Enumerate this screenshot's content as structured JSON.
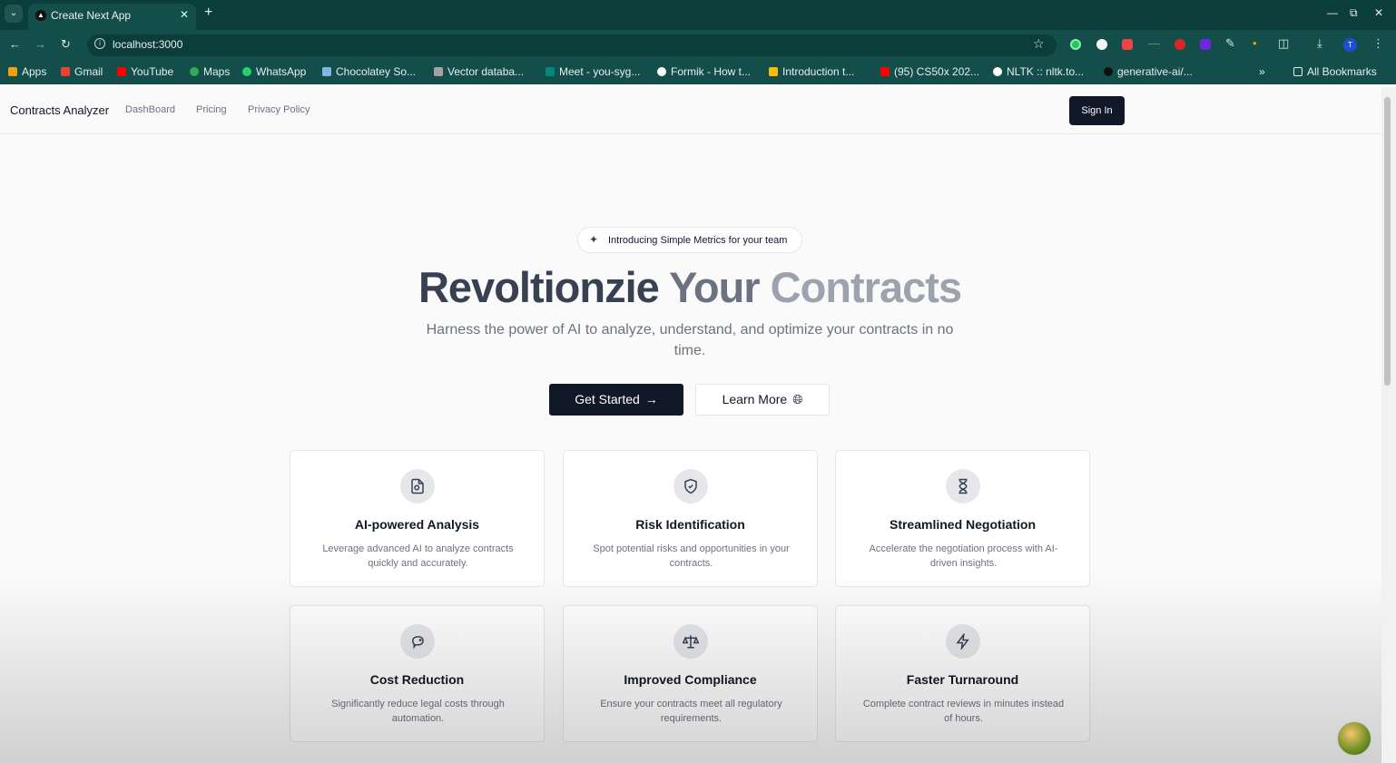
{
  "browser": {
    "tab_title": "Create Next App",
    "tab_favicon": "triangle-icon",
    "url": "localhost:3000",
    "bookmarks": [
      {
        "label": "Apps",
        "icon": "grid-icon",
        "color": "#f59e0b"
      },
      {
        "label": "Gmail",
        "icon": "gmail-icon",
        "color": "#ea4335"
      },
      {
        "label": "YouTube",
        "icon": "youtube-icon",
        "color": "#ff0000"
      },
      {
        "label": "Maps",
        "icon": "maps-icon",
        "color": "#34a853"
      },
      {
        "label": "WhatsApp",
        "icon": "whatsapp-icon",
        "color": "#25d366"
      },
      {
        "label": "Chocolatey So...",
        "icon": "chocolatey-icon",
        "color": "#80b5e3"
      },
      {
        "label": "Vector databa...",
        "icon": "vector-icon",
        "color": "#a3a3a3"
      },
      {
        "label": "Meet - you-syg...",
        "icon": "meet-icon",
        "color": "#00897b"
      },
      {
        "label": "Formik - How t...",
        "icon": "formik-icon",
        "color": "#ffffff"
      },
      {
        "label": "Introduction t...",
        "icon": "drive-icon",
        "color": "#fbbc04"
      },
      {
        "label": "(95) CS50x 202...",
        "icon": "youtube-icon",
        "color": "#ff0000"
      },
      {
        "label": "NLTK :: nltk.to...",
        "icon": "nltk-icon",
        "color": "#ffffff"
      },
      {
        "label": "generative-ai/...",
        "icon": "github-icon",
        "color": "#111111"
      }
    ],
    "all_bookmarks_label": "All Bookmarks",
    "profile_initial": "T"
  },
  "header": {
    "brand": "Contracts Analyzer",
    "nav": [
      "DashBoard",
      "Pricing",
      "Privacy Policy"
    ],
    "signin_label": "Sign In"
  },
  "hero": {
    "badge": "Introducing Simple Metrics for your team",
    "title_part1": "Revoltionzie",
    "title_part2": "Your",
    "title_part3": "Contracts",
    "subtitle": "Harness the power of AI to analyze, understand, and optimize your contracts in no time.",
    "cta_primary": "Get Started",
    "cta_secondary": "Learn More"
  },
  "features": [
    {
      "icon": "document-scan-icon",
      "title": "AI-powered Analysis",
      "desc": "Leverage advanced AI to analyze contracts quickly and accurately."
    },
    {
      "icon": "shield-check-icon",
      "title": "Risk Identification",
      "desc": "Spot potential risks and opportunities in your contracts."
    },
    {
      "icon": "hourglass-icon",
      "title": "Streamlined Negotiation",
      "desc": "Accelerate the negotiation process with AI-driven insights."
    },
    {
      "icon": "piggy-bank-icon",
      "title": "Cost Reduction",
      "desc": "Significantly reduce legal costs through automation."
    },
    {
      "icon": "scale-icon",
      "title": "Improved Compliance",
      "desc": "Ensure your contracts meet all regulatory requirements."
    },
    {
      "icon": "zap-icon",
      "title": "Faster Turnaround",
      "desc": "Complete contract reviews in minutes instead of hours."
    }
  ],
  "colors": {
    "chrome": "#134e4b",
    "chrome_dark": "#0b3d3b",
    "primary_button": "#111827",
    "page_bg": "#fafafa"
  }
}
